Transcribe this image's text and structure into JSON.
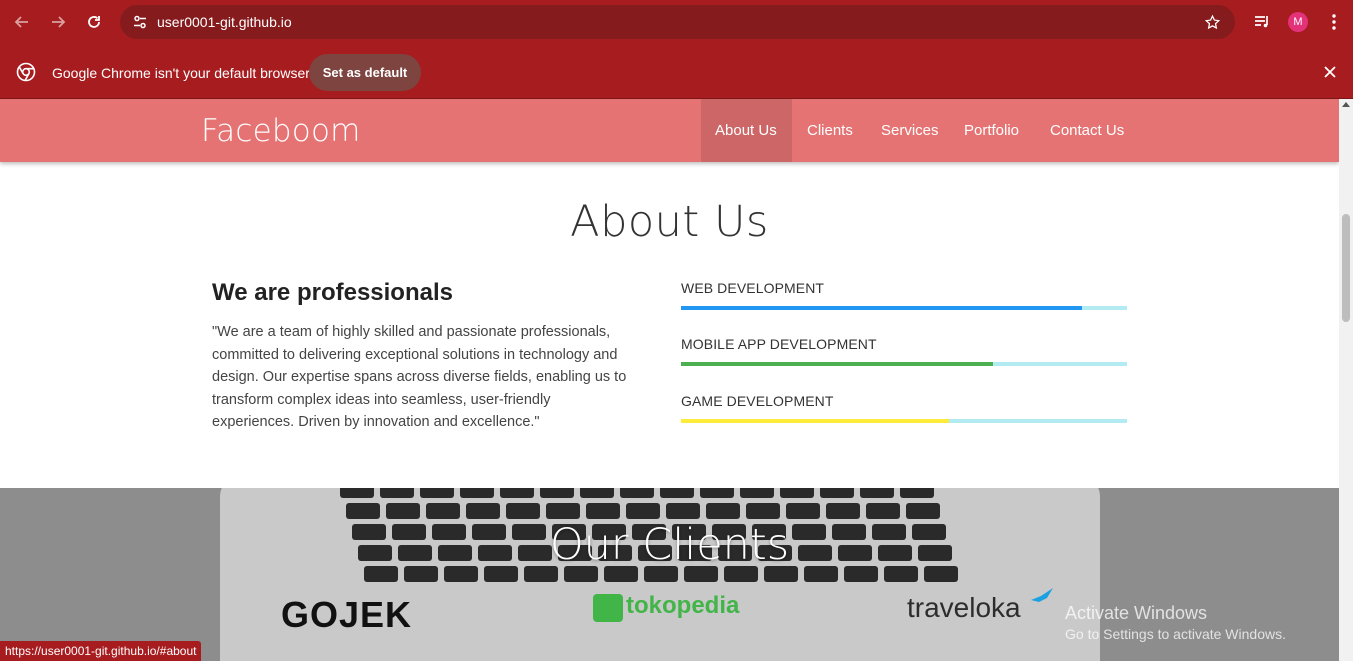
{
  "browser": {
    "url": "user0001-git.github.io",
    "avatar_letter": "M",
    "accent_color": "#a71c1f"
  },
  "infobar": {
    "message": "Google Chrome isn't your default browser",
    "set_default_label": "Set as default"
  },
  "site": {
    "brand": "Faceboom",
    "nav": [
      "About Us",
      "Clients",
      "Services",
      "Portfolio",
      "Contact Us"
    ],
    "active_nav": "About Us",
    "nav_color": "#e57373"
  },
  "about": {
    "title": "About Us",
    "heading": "We are professionals",
    "text": "\"We are a team of highly skilled and passionate professionals, committed to delivering exceptional solutions in technology and design. Our expertise spans across diverse fields, enabling us to transform complex ideas into seamless, user-friendly experiences. Driven by innovation and excellence.\"",
    "skills": [
      {
        "label": "WEB DEVELOPMENT",
        "percent": 90,
        "color": "#2196f3"
      },
      {
        "label": "MOBILE APP DEVELOPMENT",
        "percent": 70,
        "color": "#4caf50"
      },
      {
        "label": "GAME DEVELOPMENT",
        "percent": 60,
        "color": "#ffeb3b"
      }
    ]
  },
  "clients": {
    "title": "Our Clients",
    "logos": [
      "GOJEK",
      "tokopedia",
      "traveloka"
    ]
  },
  "watermark": {
    "title": "Activate Windows",
    "subtitle": "Go to Settings to activate Windows."
  },
  "status_bar": {
    "link": "https://user0001-git.github.io/#about"
  }
}
